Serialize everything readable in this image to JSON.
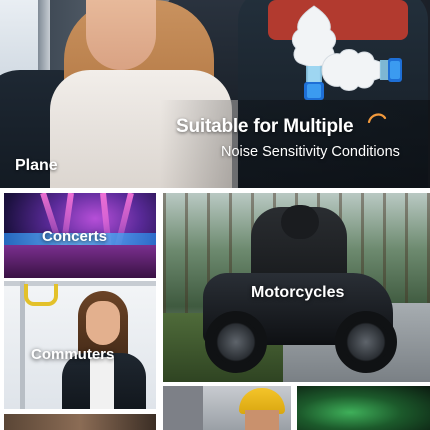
{
  "hero": {
    "headline": "Suitable for Multiple",
    "subheadline": "Noise Sensitivity Conditions",
    "scene_label": "Plane",
    "accent_color": "#f39a3c"
  },
  "tiles": [
    {
      "label": "Concerts"
    },
    {
      "label": "Commuters"
    },
    {
      "label": "Motorcycles"
    }
  ]
}
